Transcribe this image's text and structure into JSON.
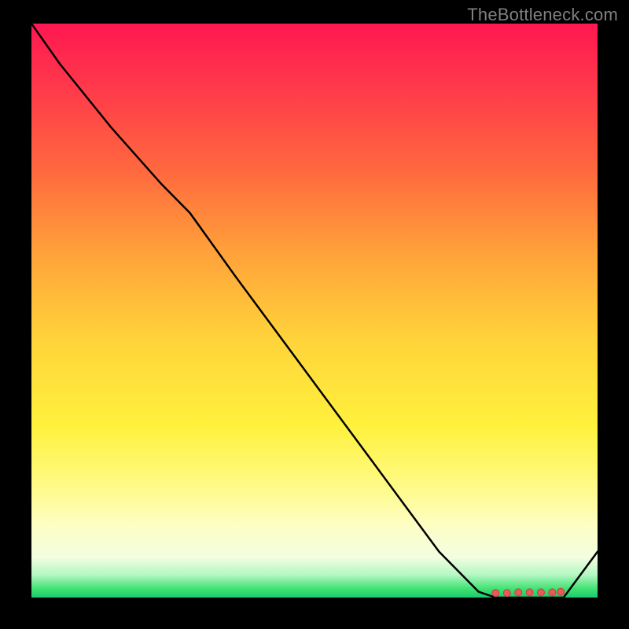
{
  "watermark": "TheBottleneck.com",
  "chart_data": {
    "type": "line",
    "title": "",
    "xlabel": "",
    "ylabel": "",
    "xlim": [
      0,
      100
    ],
    "ylim": [
      0,
      100
    ],
    "grid": false,
    "legend": false,
    "series": [
      {
        "name": "curve",
        "x": [
          0,
          5,
          14,
          23,
          28,
          36,
          48,
          60,
          72,
          79,
          82,
          86,
          90,
          94,
          100
        ],
        "y": [
          100,
          93,
          82,
          72,
          67,
          56,
          40,
          24,
          8,
          1,
          0,
          0,
          0,
          0,
          8
        ]
      }
    ],
    "markers": {
      "name": "bottom-markers",
      "x": [
        82,
        84,
        86,
        88,
        90,
        92,
        93.5
      ],
      "y": [
        0.8,
        0.8,
        0.9,
        0.9,
        0.9,
        0.9,
        1.0
      ]
    },
    "gradient_stops": [
      {
        "pct": 0,
        "color": "#ff1751"
      },
      {
        "pct": 12,
        "color": "#ff3c4a"
      },
      {
        "pct": 26,
        "color": "#ff6a3e"
      },
      {
        "pct": 40,
        "color": "#ffa23a"
      },
      {
        "pct": 55,
        "color": "#ffd33a"
      },
      {
        "pct": 70,
        "color": "#fff13c"
      },
      {
        "pct": 80,
        "color": "#fffa82"
      },
      {
        "pct": 88,
        "color": "#fdfec8"
      },
      {
        "pct": 93,
        "color": "#f2fee0"
      },
      {
        "pct": 96,
        "color": "#b6f7c4"
      },
      {
        "pct": 98.5,
        "color": "#3fe272"
      },
      {
        "pct": 100,
        "color": "#1acb6d"
      }
    ],
    "colors": {
      "curve": "#000000",
      "marker_fill": "#e85a5a",
      "marker_stroke": "#c64040",
      "background": "#000000"
    }
  }
}
